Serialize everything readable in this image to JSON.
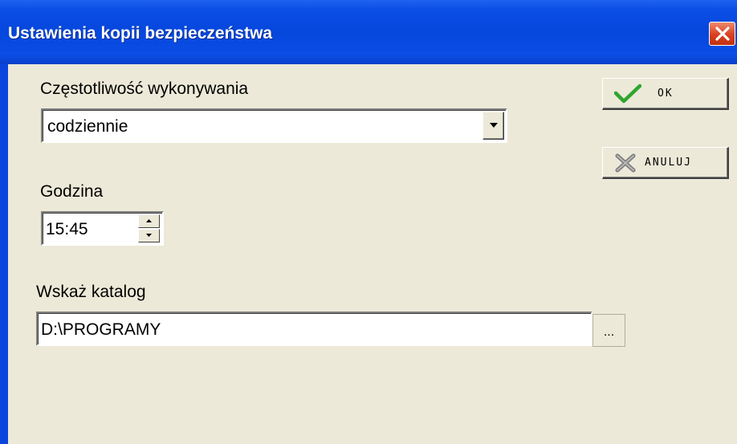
{
  "window": {
    "title": "Ustawienia kopii bezpieczeństwa"
  },
  "frequency": {
    "label": "Częstotliwość wykonywania",
    "selected_value": "codziennie"
  },
  "time": {
    "label": "Godzina",
    "value": "15:45"
  },
  "directory": {
    "label": "Wskaż katalog",
    "value": "D:\\PROGRAMY",
    "browse_label": "..."
  },
  "buttons": {
    "ok_label": "OK",
    "cancel_label": "ANULUJ"
  },
  "icons": {
    "close": "close-icon",
    "ok": "checkmark-icon",
    "cancel": "cross-icon",
    "dropdown": "chevron-down-icon",
    "spin_up": "arrow-up-icon",
    "spin_down": "arrow-down-icon"
  },
  "colors": {
    "titlebar": "#0a4ee6",
    "dialog_bg": "#ece9d8",
    "close_button": "#d8401f",
    "ok_check": "#2fa52f"
  }
}
